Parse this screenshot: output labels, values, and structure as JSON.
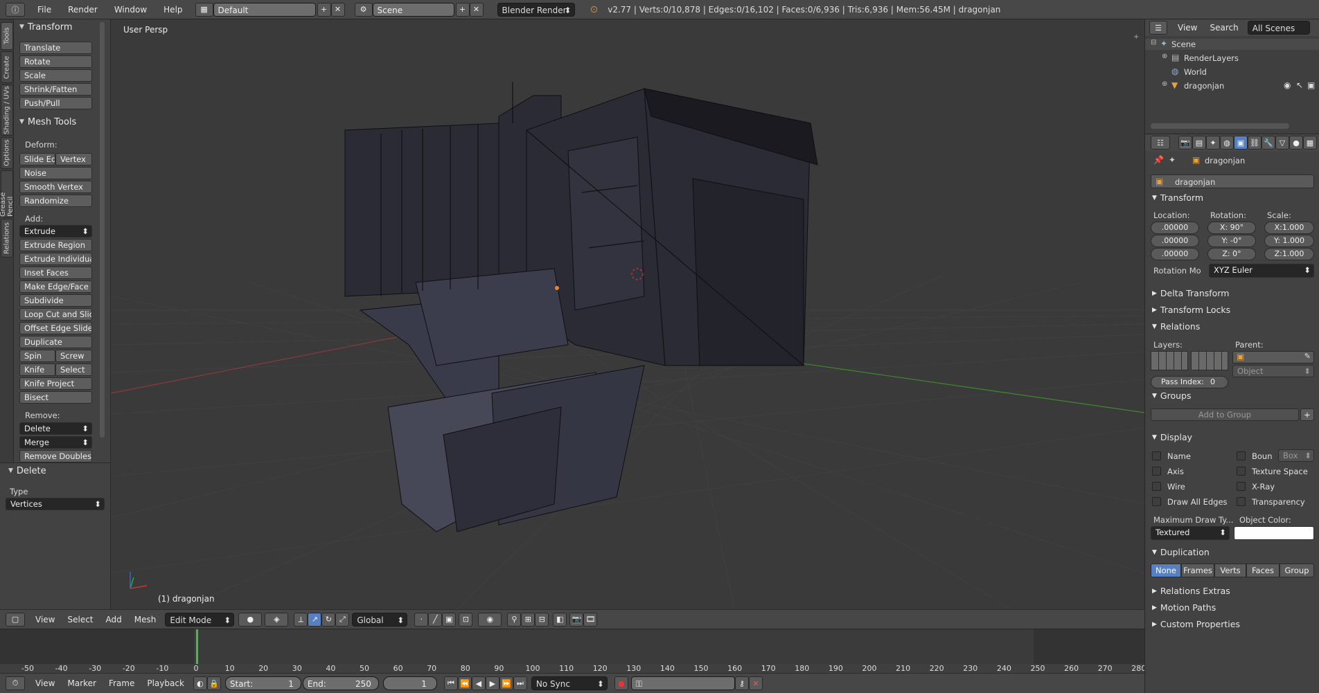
{
  "topbar": {
    "menus": [
      "File",
      "Render",
      "Window",
      "Help"
    ],
    "layout": "Default",
    "scene": "Scene",
    "engine": "Blender Render",
    "status": "v2.77 | Verts:0/10,878 | Edges:0/16,102 | Faces:0/6,936 | Tris:6,936 | Mem:56.45M | dragonjan"
  },
  "tabs": [
    "Tools",
    "Create",
    "Shading / UVs",
    "Options",
    "Grease Pencil",
    "Relations"
  ],
  "toolshelf": {
    "transform_title": "Transform",
    "transform_buttons": [
      "Translate",
      "Rotate",
      "Scale",
      "Shrink/Fatten",
      "Push/Pull"
    ],
    "meshtools_title": "Mesh Tools",
    "deform_label": "Deform:",
    "slide_edge": "Slide Ed",
    "vertex": "Vertex",
    "deform_buttons": [
      "Noise",
      "Smooth Vertex",
      "Randomize"
    ],
    "add_label": "Add:",
    "extrude": "Extrude",
    "add_buttons": [
      "Extrude Region",
      "Extrude Individual",
      "Inset Faces",
      "Make Edge/Face",
      "Subdivide",
      "Loop Cut and Slide",
      "Offset Edge Slide",
      "Duplicate"
    ],
    "spin": "Spin",
    "screw": "Screw",
    "knife": "Knife",
    "select": "Select",
    "knife_project": "Knife Project",
    "bisect": "Bisect",
    "remove_label": "Remove:",
    "delete": "Delete",
    "merge": "Merge",
    "remove_doubles": "Remove Doubles"
  },
  "operator": {
    "title": "Delete",
    "type_label": "Type",
    "type_value": "Vertices"
  },
  "viewport": {
    "view_label": "User Persp",
    "object_label": "(1) dragonjan"
  },
  "view3d_header": {
    "menus": [
      "View",
      "Select",
      "Add",
      "Mesh"
    ],
    "mode": "Edit Mode",
    "orientation": "Global"
  },
  "timeline": {
    "ticks": [
      "-50",
      "-40",
      "-30",
      "-20",
      "-10",
      "0",
      "10",
      "20",
      "30",
      "40",
      "50",
      "60",
      "70",
      "80",
      "90",
      "100",
      "110",
      "120",
      "130",
      "140",
      "150",
      "160",
      "170",
      "180",
      "190",
      "200",
      "210",
      "220",
      "230",
      "240",
      "250",
      "260",
      "270",
      "280"
    ],
    "current_frame_marker": 1
  },
  "timeline_header": {
    "menus": [
      "View",
      "Marker",
      "Frame",
      "Playback"
    ],
    "start_label": "Start:",
    "start_value": "1",
    "end_label": "End:",
    "end_value": "250",
    "current": "1",
    "sync": "No Sync"
  },
  "outliner": {
    "menus": [
      "View",
      "Search"
    ],
    "scope": "All Scenes",
    "items": [
      "Scene",
      "RenderLayers",
      "World",
      "dragonjan"
    ]
  },
  "properties": {
    "context_object": "dragonjan",
    "object_name": "dragonjan",
    "transform_title": "Transform",
    "location_label": "Location:",
    "rotation_label": "Rotation:",
    "scale_label": "Scale:",
    "location": [
      ".00000",
      ".00000",
      ".00000"
    ],
    "rotation": [
      "X:   90°",
      "Y:   -0°",
      "Z:    0°"
    ],
    "scale": [
      "X:1.000",
      "Y: 1.000",
      "Z:1.000"
    ],
    "rotation_mode_label": "Rotation Mo",
    "rotation_mode": "XYZ Euler",
    "delta_transform": "Delta Transform",
    "transform_locks": "Transform Locks",
    "relations": "Relations",
    "layers_label": "Layers:",
    "parent_label": "Parent:",
    "parent_type": "Object",
    "pass_index_label": "Pass Index:",
    "pass_index": "0",
    "groups": "Groups",
    "add_to_group": "Add to Group",
    "display": "Display",
    "display_checks_left": [
      "Name",
      "Axis",
      "Wire",
      "Draw All Edges"
    ],
    "display_checks_right": [
      "Boun",
      "Texture Space",
      "X-Ray",
      "Transparency"
    ],
    "bounds_type": "Box",
    "max_draw_label": "Maximum Draw Ty...",
    "max_draw": "Textured",
    "object_color_label": "Object Color:",
    "duplication": "Duplication",
    "dup_options": [
      "None",
      "Frames",
      "Verts",
      "Faces",
      "Group"
    ],
    "relations_extras": "Relations Extras",
    "motion_paths": "Motion Paths",
    "custom_properties": "Custom Properties"
  },
  "colors": {
    "accent": "#5680c2",
    "x_axis": "#a04040",
    "y_axis": "#4a9a3a",
    "frame_marker": "#3fc13f"
  }
}
